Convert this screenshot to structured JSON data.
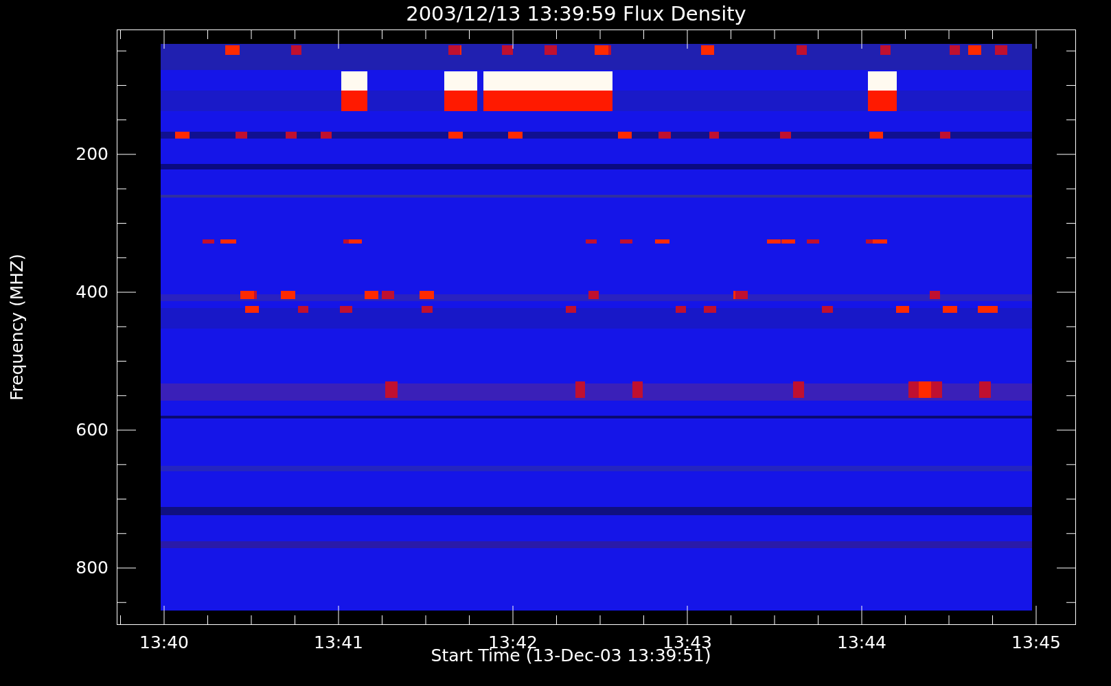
{
  "title": "2003/12/13 13:39:59 Flux Density",
  "y_axis": {
    "label": "Frequency (MHZ)",
    "ticks": [
      "200",
      "400",
      "600",
      "800"
    ]
  },
  "x_axis": {
    "label": "Start Time (13-Dec-03 13:39:51)",
    "ticks": [
      "13:40",
      "13:41",
      "13:42",
      "13:43",
      "13:44",
      "13:45"
    ]
  }
}
